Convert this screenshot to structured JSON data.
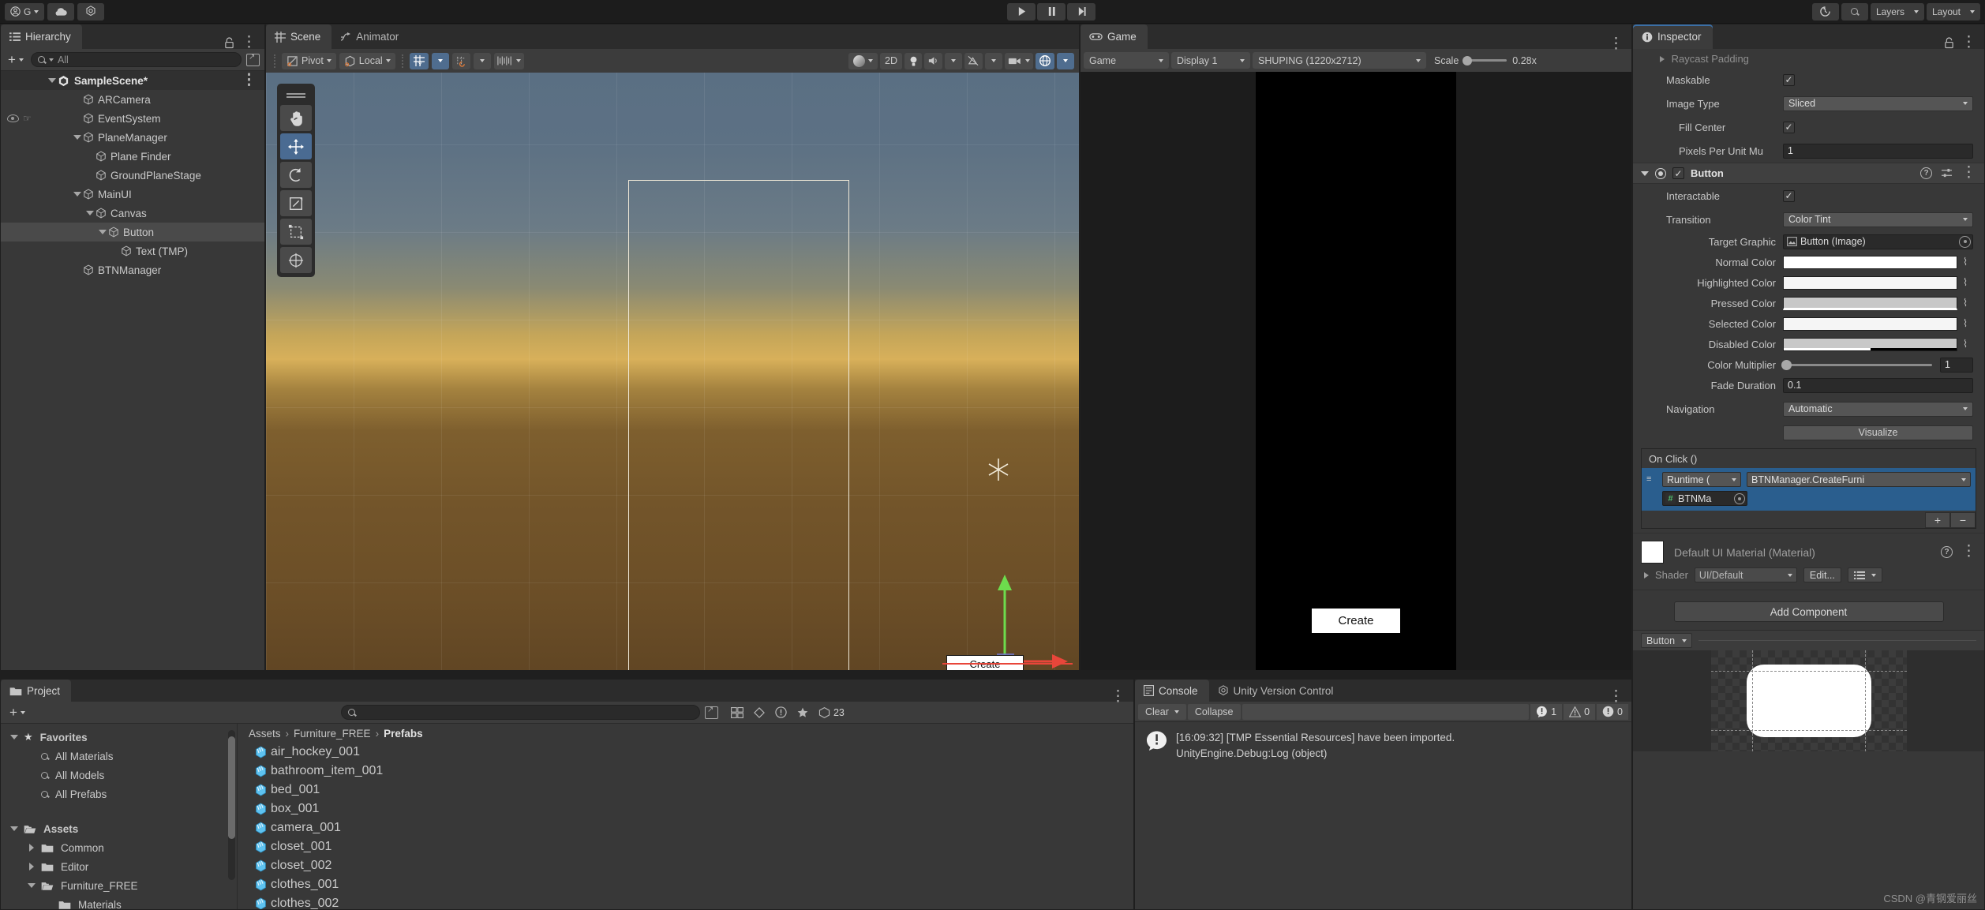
{
  "toolbar": {
    "account_label": "G",
    "cloud_icon": "cloud-icon",
    "collab_icon": "collab-icon",
    "play_icon": "play-icon",
    "pause_icon": "pause-icon",
    "step_icon": "step-icon",
    "history_icon": "history-icon",
    "search_icon": "search-icon",
    "layers_label": "Layers",
    "layout_label": "Layout"
  },
  "hierarchy": {
    "tab_label": "Hierarchy",
    "search_placeholder": "All",
    "add_label": "+",
    "items": [
      {
        "label": "SampleScene*",
        "depth": 0,
        "icon": "unity-scene-icon",
        "expanded": true,
        "selected": false,
        "root": true,
        "visibility": false
      },
      {
        "label": "ARCamera",
        "depth": 2,
        "icon": "gameobject-icon",
        "expanded": null,
        "selected": false,
        "visibility": false
      },
      {
        "label": "EventSystem",
        "depth": 2,
        "icon": "gameobject-icon",
        "expanded": null,
        "selected": false,
        "visibility": true
      },
      {
        "label": "PlaneManager",
        "depth": 2,
        "icon": "gameobject-icon",
        "expanded": true,
        "selected": false,
        "visibility": false
      },
      {
        "label": "Plane Finder",
        "depth": 3,
        "icon": "gameobject-icon",
        "expanded": null,
        "selected": false,
        "visibility": false
      },
      {
        "label": "GroundPlaneStage",
        "depth": 3,
        "icon": "gameobject-icon",
        "expanded": null,
        "selected": false,
        "visibility": false
      },
      {
        "label": "MainUI",
        "depth": 2,
        "icon": "gameobject-icon",
        "expanded": true,
        "selected": false,
        "visibility": false
      },
      {
        "label": "Canvas",
        "depth": 3,
        "icon": "gameobject-icon",
        "expanded": true,
        "selected": false,
        "visibility": false
      },
      {
        "label": "Button",
        "depth": 4,
        "icon": "gameobject-icon",
        "expanded": true,
        "selected": true,
        "visibility": false
      },
      {
        "label": "Text (TMP)",
        "depth": 5,
        "icon": "gameobject-icon",
        "expanded": null,
        "selected": false,
        "visibility": false
      },
      {
        "label": "BTNManager",
        "depth": 2,
        "icon": "gameobject-icon",
        "expanded": null,
        "selected": false,
        "visibility": false
      }
    ]
  },
  "scene": {
    "tabs": [
      {
        "label": "Scene",
        "icon": "grid-icon",
        "active": true
      },
      {
        "label": "Animator",
        "icon": "animator-icon",
        "active": false
      }
    ],
    "pivot_label": "Pivot",
    "local_label": "Local",
    "grid_snap_icon": "grid-snap-icon",
    "snap_increment_icon": "snap-increment-icon",
    "ruler_icon": "ruler-icon",
    "shading_icon": "shading-mode-icon",
    "twod_label": "2D",
    "lighting_icon": "lighting-icon",
    "audio_icon": "audio-icon",
    "fx_icon": "effects-icon",
    "hidden_icon": "hidden-objects-icon",
    "camera_icon": "scene-camera-icon",
    "gizmos_icon": "gizmos-icon",
    "tools": [
      {
        "name": "hand-tool",
        "glyph": "✋",
        "active": false
      },
      {
        "name": "move-tool",
        "glyph": "move",
        "active": true
      },
      {
        "name": "rotate-tool",
        "glyph": "rotate",
        "active": false
      },
      {
        "name": "scale-tool",
        "glyph": "scale",
        "active": false
      },
      {
        "name": "rect-tool",
        "glyph": "rect",
        "active": false
      },
      {
        "name": "transform-tool",
        "glyph": "transform",
        "active": false
      }
    ],
    "button_label": "Create"
  },
  "game": {
    "tab_label": "Game",
    "view_mode": "Game",
    "display": "Display 1",
    "resolution": "SHUPING (1220x2712)",
    "scale_label": "Scale",
    "scale_value": "0.28x",
    "button_label": "Create"
  },
  "inspector": {
    "tab_label": "Inspector",
    "image_section": {
      "raycast_padding_label": "Raycast Padding",
      "maskable_label": "Maskable",
      "maskable_checked": true,
      "image_type_label": "Image Type",
      "image_type_value": "Sliced",
      "fill_center_label": "Fill Center",
      "fill_center_checked": true,
      "pixels_per_unit_label": "Pixels Per Unit Mu",
      "pixels_per_unit_value": "1"
    },
    "button_component": {
      "title": "Button",
      "enabled": true,
      "interactable_label": "Interactable",
      "interactable_checked": true,
      "transition_label": "Transition",
      "transition_value": "Color Tint",
      "target_graphic_label": "Target Graphic",
      "target_graphic_value": "Button (Image)",
      "normal_color_label": "Normal Color",
      "normal_color_value": "#FFFFFF",
      "highlighted_color_label": "Highlighted Color",
      "highlighted_color_value": "#F5F5F5",
      "pressed_color_label": "Pressed Color",
      "pressed_color_value": "#C8C8C8",
      "selected_color_label": "Selected Color",
      "selected_color_value": "#F5F5F5",
      "disabled_color_label": "Disabled Color",
      "disabled_color_value": "#C8C8C8",
      "color_multiplier_label": "Color Multiplier",
      "color_multiplier_value": "1",
      "fade_duration_label": "Fade Duration",
      "fade_duration_value": "0.1",
      "navigation_label": "Navigation",
      "navigation_value": "Automatic",
      "visualize_label": "Visualize"
    },
    "on_click": {
      "title": "On Click ()",
      "runtime_value": "Runtime (",
      "function_value": "BTNManager.CreateFurni",
      "object_value": "BTNMa",
      "add_label": "+",
      "remove_label": "−"
    },
    "material": {
      "title": "Default UI Material (Material)",
      "shader_label": "Shader",
      "shader_value": "UI/Default",
      "edit_label": "Edit..."
    },
    "add_component_label": "Add Component",
    "preview_dropdown": "Button"
  },
  "project": {
    "tab_label": "Project",
    "add_label": "+",
    "search_placeholder": "",
    "favorites": {
      "label": "Favorites",
      "items": [
        "All Materials",
        "All Models",
        "All Prefabs"
      ]
    },
    "assets": {
      "label": "Assets",
      "items": [
        {
          "label": "Common",
          "depth": 1,
          "expanded": false,
          "open": false
        },
        {
          "label": "Editor",
          "depth": 1,
          "expanded": false,
          "open": false
        },
        {
          "label": "Furniture_FREE",
          "depth": 1,
          "expanded": true,
          "open": true
        },
        {
          "label": "Materials",
          "depth": 2,
          "expanded": null,
          "open": false
        }
      ]
    },
    "breadcrumb": [
      "Assets",
      "Furniture_FREE",
      "Prefabs"
    ],
    "files": [
      "air_hockey_001",
      "bathroom_item_001",
      "bed_001",
      "box_001",
      "camera_001",
      "closet_001",
      "closet_002",
      "clothes_001",
      "clothes_002"
    ],
    "favorites_count": "23"
  },
  "console": {
    "tabs": [
      {
        "label": "Console",
        "icon": "console-icon",
        "active": true
      },
      {
        "label": "Unity Version Control",
        "icon": "version-control-icon",
        "active": false
      }
    ],
    "clear_label": "Clear",
    "collapse_label": "Collapse",
    "counts": {
      "log": "1",
      "warning": "0",
      "error": "0"
    },
    "entries": [
      {
        "icon": "info-icon",
        "line1": "[16:09:32] [TMP Essential Resources] have been imported.",
        "line2": "UnityEngine.Debug:Log (object)"
      }
    ]
  },
  "watermark": "CSDN @青钢爱丽丝",
  "colors": {
    "accent_blue": "#2a5e8e",
    "panel_bg": "#383838",
    "toolbar_bg": "#3c3c3c",
    "window_bg": "#1f1f1f"
  }
}
